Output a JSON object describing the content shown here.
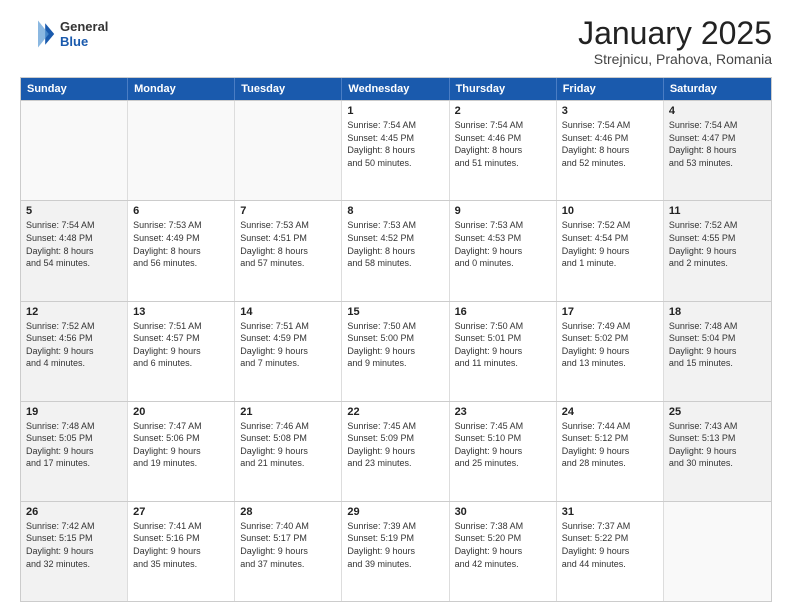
{
  "logo": {
    "general": "General",
    "blue": "Blue"
  },
  "title": "January 2025",
  "subtitle": "Strejnicu, Prahova, Romania",
  "days": [
    "Sunday",
    "Monday",
    "Tuesday",
    "Wednesday",
    "Thursday",
    "Friday",
    "Saturday"
  ],
  "weeks": [
    [
      {
        "num": "",
        "text": "",
        "empty": true
      },
      {
        "num": "",
        "text": "",
        "empty": true
      },
      {
        "num": "",
        "text": "",
        "empty": true
      },
      {
        "num": "1",
        "text": "Sunrise: 7:54 AM\nSunset: 4:45 PM\nDaylight: 8 hours\nand 50 minutes.",
        "empty": false
      },
      {
        "num": "2",
        "text": "Sunrise: 7:54 AM\nSunset: 4:46 PM\nDaylight: 8 hours\nand 51 minutes.",
        "empty": false
      },
      {
        "num": "3",
        "text": "Sunrise: 7:54 AM\nSunset: 4:46 PM\nDaylight: 8 hours\nand 52 minutes.",
        "empty": false
      },
      {
        "num": "4",
        "text": "Sunrise: 7:54 AM\nSunset: 4:47 PM\nDaylight: 8 hours\nand 53 minutes.",
        "empty": false
      }
    ],
    [
      {
        "num": "5",
        "text": "Sunrise: 7:54 AM\nSunset: 4:48 PM\nDaylight: 8 hours\nand 54 minutes.",
        "empty": false
      },
      {
        "num": "6",
        "text": "Sunrise: 7:53 AM\nSunset: 4:49 PM\nDaylight: 8 hours\nand 56 minutes.",
        "empty": false
      },
      {
        "num": "7",
        "text": "Sunrise: 7:53 AM\nSunset: 4:51 PM\nDaylight: 8 hours\nand 57 minutes.",
        "empty": false
      },
      {
        "num": "8",
        "text": "Sunrise: 7:53 AM\nSunset: 4:52 PM\nDaylight: 8 hours\nand 58 minutes.",
        "empty": false
      },
      {
        "num": "9",
        "text": "Sunrise: 7:53 AM\nSunset: 4:53 PM\nDaylight: 9 hours\nand 0 minutes.",
        "empty": false
      },
      {
        "num": "10",
        "text": "Sunrise: 7:52 AM\nSunset: 4:54 PM\nDaylight: 9 hours\nand 1 minute.",
        "empty": false
      },
      {
        "num": "11",
        "text": "Sunrise: 7:52 AM\nSunset: 4:55 PM\nDaylight: 9 hours\nand 2 minutes.",
        "empty": false
      }
    ],
    [
      {
        "num": "12",
        "text": "Sunrise: 7:52 AM\nSunset: 4:56 PM\nDaylight: 9 hours\nand 4 minutes.",
        "empty": false
      },
      {
        "num": "13",
        "text": "Sunrise: 7:51 AM\nSunset: 4:57 PM\nDaylight: 9 hours\nand 6 minutes.",
        "empty": false
      },
      {
        "num": "14",
        "text": "Sunrise: 7:51 AM\nSunset: 4:59 PM\nDaylight: 9 hours\nand 7 minutes.",
        "empty": false
      },
      {
        "num": "15",
        "text": "Sunrise: 7:50 AM\nSunset: 5:00 PM\nDaylight: 9 hours\nand 9 minutes.",
        "empty": false
      },
      {
        "num": "16",
        "text": "Sunrise: 7:50 AM\nSunset: 5:01 PM\nDaylight: 9 hours\nand 11 minutes.",
        "empty": false
      },
      {
        "num": "17",
        "text": "Sunrise: 7:49 AM\nSunset: 5:02 PM\nDaylight: 9 hours\nand 13 minutes.",
        "empty": false
      },
      {
        "num": "18",
        "text": "Sunrise: 7:48 AM\nSunset: 5:04 PM\nDaylight: 9 hours\nand 15 minutes.",
        "empty": false
      }
    ],
    [
      {
        "num": "19",
        "text": "Sunrise: 7:48 AM\nSunset: 5:05 PM\nDaylight: 9 hours\nand 17 minutes.",
        "empty": false
      },
      {
        "num": "20",
        "text": "Sunrise: 7:47 AM\nSunset: 5:06 PM\nDaylight: 9 hours\nand 19 minutes.",
        "empty": false
      },
      {
        "num": "21",
        "text": "Sunrise: 7:46 AM\nSunset: 5:08 PM\nDaylight: 9 hours\nand 21 minutes.",
        "empty": false
      },
      {
        "num": "22",
        "text": "Sunrise: 7:45 AM\nSunset: 5:09 PM\nDaylight: 9 hours\nand 23 minutes.",
        "empty": false
      },
      {
        "num": "23",
        "text": "Sunrise: 7:45 AM\nSunset: 5:10 PM\nDaylight: 9 hours\nand 25 minutes.",
        "empty": false
      },
      {
        "num": "24",
        "text": "Sunrise: 7:44 AM\nSunset: 5:12 PM\nDaylight: 9 hours\nand 28 minutes.",
        "empty": false
      },
      {
        "num": "25",
        "text": "Sunrise: 7:43 AM\nSunset: 5:13 PM\nDaylight: 9 hours\nand 30 minutes.",
        "empty": false
      }
    ],
    [
      {
        "num": "26",
        "text": "Sunrise: 7:42 AM\nSunset: 5:15 PM\nDaylight: 9 hours\nand 32 minutes.",
        "empty": false
      },
      {
        "num": "27",
        "text": "Sunrise: 7:41 AM\nSunset: 5:16 PM\nDaylight: 9 hours\nand 35 minutes.",
        "empty": false
      },
      {
        "num": "28",
        "text": "Sunrise: 7:40 AM\nSunset: 5:17 PM\nDaylight: 9 hours\nand 37 minutes.",
        "empty": false
      },
      {
        "num": "29",
        "text": "Sunrise: 7:39 AM\nSunset: 5:19 PM\nDaylight: 9 hours\nand 39 minutes.",
        "empty": false
      },
      {
        "num": "30",
        "text": "Sunrise: 7:38 AM\nSunset: 5:20 PM\nDaylight: 9 hours\nand 42 minutes.",
        "empty": false
      },
      {
        "num": "31",
        "text": "Sunrise: 7:37 AM\nSunset: 5:22 PM\nDaylight: 9 hours\nand 44 minutes.",
        "empty": false
      },
      {
        "num": "",
        "text": "",
        "empty": true
      }
    ]
  ]
}
